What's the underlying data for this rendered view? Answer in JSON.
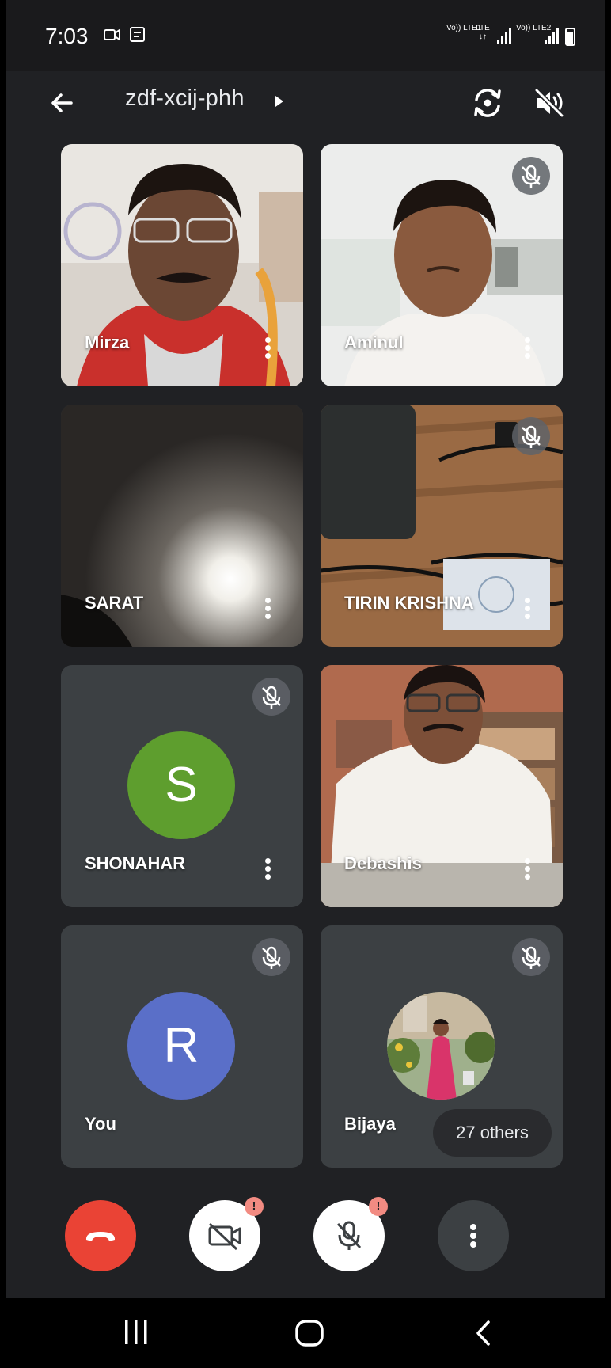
{
  "status_bar": {
    "time": "7:03",
    "network_1": "Vo)) LTE1",
    "network_2": "LTE ↓↑",
    "network_3": "Vo)) LTE2"
  },
  "header": {
    "meeting_code": "zdf-xcij-phh",
    "icons": [
      "back-arrow-icon",
      "switch-camera-icon",
      "speaker-off-icon"
    ]
  },
  "participants": [
    {
      "name": "Mirza",
      "muted": false,
      "video": true
    },
    {
      "name": "Aminul",
      "muted": true,
      "video": true
    },
    {
      "name": "SARAT",
      "muted": false,
      "video": true
    },
    {
      "name": "TIRIN KRISHNA",
      "muted": true,
      "video": true
    },
    {
      "name": "SHONAHAR",
      "muted": true,
      "video": false,
      "avatar_letter": "S",
      "avatar_color": "#5e9e2e"
    },
    {
      "name": "Debashis",
      "muted": false,
      "video": true
    },
    {
      "name": "You",
      "muted": true,
      "video": false,
      "avatar_letter": "R",
      "avatar_color": "#5a6fc8"
    },
    {
      "name": "Bijaya",
      "muted": true,
      "video": false
    }
  ],
  "others_chip": "27 others",
  "controls": {
    "end_call_color": "#ea4335",
    "camera_warning": "!",
    "mic_warning": "!"
  }
}
